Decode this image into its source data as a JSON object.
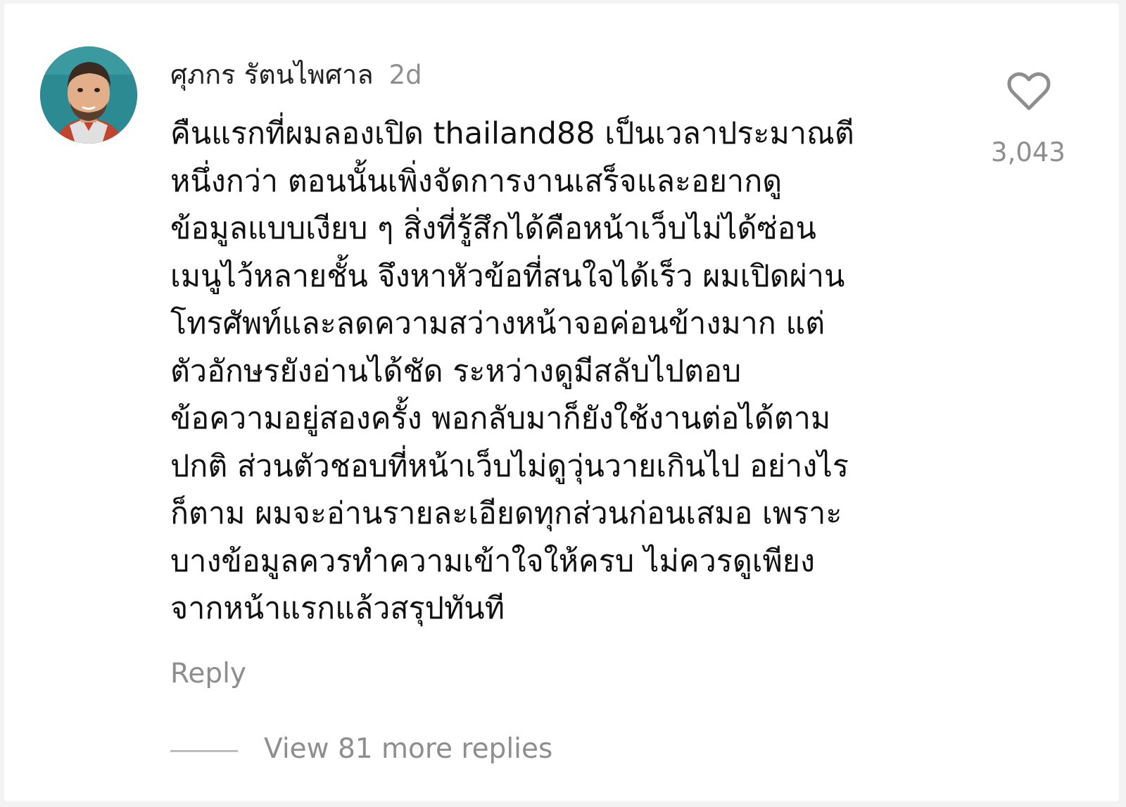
{
  "comment": {
    "username": "ศุภกร รัตนไพศาล",
    "time": "2d",
    "text_lines": [
      "คืนแรกที่ผมลองเปิด thailand88 เป็นเวลาประมาณตี",
      "หนึ่งกว่า ตอนนั้นเพิ่งจัดการงานเสร็จและอยากดู",
      "ข้อมูลแบบเงียบ ๆ สิ่งที่รู้สึกได้คือหน้าเว็บไม่ได้ซ่อน",
      "เมนูไว้หลายชั้น จึงหาหัวข้อที่สนใจได้เร็ว ผมเปิดผ่าน",
      "โทรศัพท์และลดความสว่างหน้าจอค่อนข้างมาก แต่",
      "ตัวอักษรยังอ่านได้ชัด ระหว่างดูมีสลับไปตอบ",
      "ข้อความอยู่สองครั้ง พอกลับมาก็ยังใช้งานต่อได้ตาม",
      "ปกติ ส่วนตัวชอบที่หน้าเว็บไม่ดูวุ่นวายเกินไป อย่างไร",
      "ก็ตาม ผมจะอ่านรายละเอียดทุกส่วนก่อนเสมอ เพราะ",
      "บางข้อมูลควรทำความเข้าใจให้ครบ ไม่ควรดูเพียง",
      "จากหน้าแรกแล้วสรุปทันที"
    ],
    "like_count": "3,043",
    "reply_label": "Reply",
    "view_replies_label": "View 81 more replies"
  },
  "icons": {
    "like": "heart-outline-icon"
  },
  "colors": {
    "text": "#111111",
    "muted": "#8e8e8e",
    "background": "#ffffff"
  }
}
